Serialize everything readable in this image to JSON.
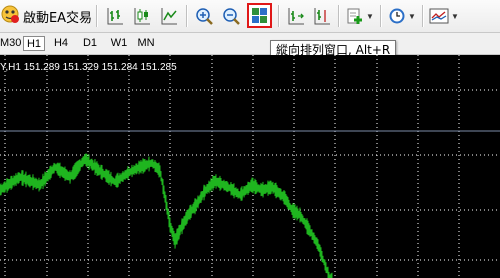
{
  "toolbar": {
    "ea_label": "啟動EA交易",
    "colors": {
      "accent_highlight": "#e01818",
      "icon_green": "#1a8a1a",
      "icon_blue": "#1f5fb4"
    }
  },
  "tooltip": {
    "text": "縱向排列窗口, Alt+R"
  },
  "timeframes": {
    "items": [
      "M30",
      "H1",
      "H4",
      "D1",
      "W1",
      "MN"
    ],
    "active": "H1"
  },
  "chart": {
    "header": "Y,H1  151.289 151.329 151.284 151.285",
    "colors": {
      "background": "#000000",
      "grid": "#ffffff",
      "price": "#1fb51f",
      "current_line": "#7b8ba8"
    }
  }
}
